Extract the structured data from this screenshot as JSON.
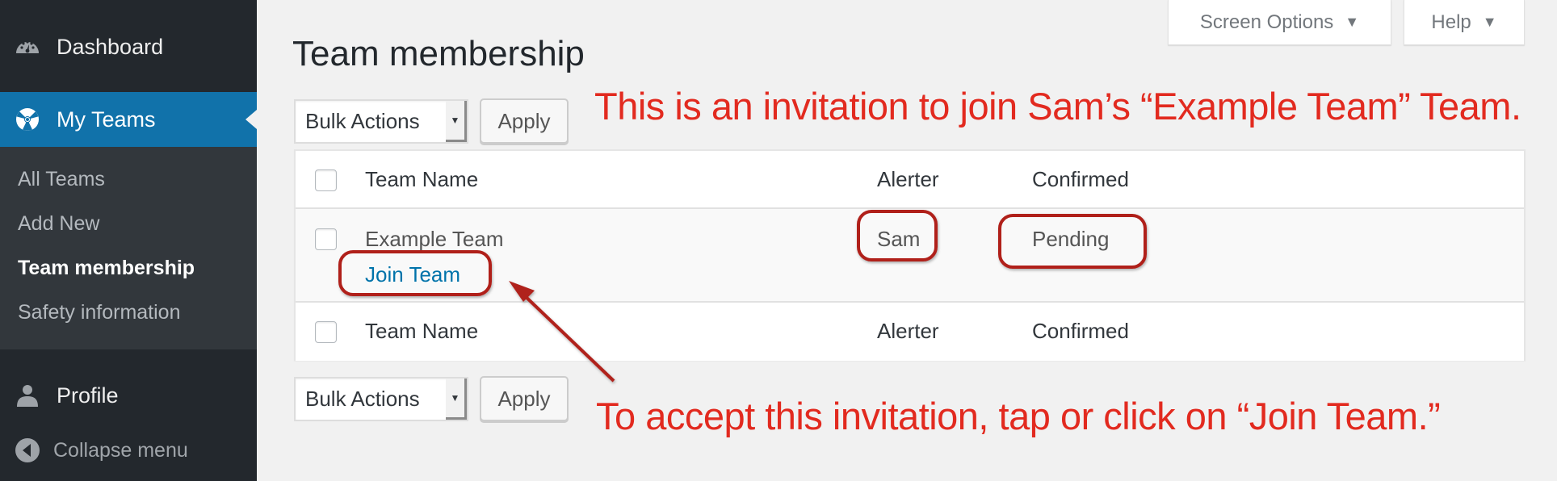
{
  "sidebar": {
    "dashboard": {
      "label": "Dashboard",
      "icon": "dashboard-gauge-icon"
    },
    "my_teams": {
      "label": "My Teams",
      "icon": "lifebuoy-icon"
    },
    "submenu": [
      {
        "label": "All Teams",
        "current": false
      },
      {
        "label": "Add New",
        "current": false
      },
      {
        "label": "Team membership",
        "current": true
      },
      {
        "label": "Safety information",
        "current": false
      }
    ],
    "profile": {
      "label": "Profile",
      "icon": "user-icon"
    },
    "collapse": {
      "label": "Collapse menu",
      "icon": "collapse-arrow-icon"
    }
  },
  "screen_meta": {
    "screen_options": "Screen Options",
    "help": "Help"
  },
  "page": {
    "title": "Team membership"
  },
  "bulk_actions": {
    "selected": "Bulk Actions",
    "apply": "Apply"
  },
  "table": {
    "columns": [
      "Team Name",
      "Alerter",
      "Confirmed"
    ],
    "rows": [
      {
        "team_name": "Example Team",
        "alerter": "Sam",
        "confirmed": "Pending",
        "row_action": "Join Team"
      }
    ]
  },
  "annotations": {
    "top": "This is an invitation to join Sam’s “Example Team” Team.",
    "bottom": "To accept this invitation, tap or click on “Join Team.”",
    "color": "#e22a1f",
    "box_color": "#b0201a"
  },
  "colors": {
    "sidebar_bg": "#23282d",
    "submenu_bg": "#32373c",
    "active_bg": "#1172aa",
    "link": "#0073aa"
  }
}
